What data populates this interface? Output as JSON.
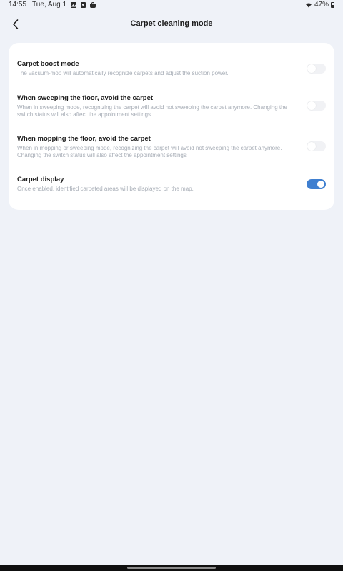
{
  "status_bar": {
    "time": "14:55",
    "date": "Tue, Aug 1",
    "battery": "47%",
    "icons": [
      "gallery-icon",
      "notification-icon",
      "basket-icon",
      "wifi-icon",
      "battery-icon"
    ]
  },
  "header": {
    "title": "Carpet cleaning mode",
    "back_icon": "chevron-left-icon"
  },
  "settings": [
    {
      "title": "Carpet boost mode",
      "description": "The vacuum-mop will automatically recognize carpets and adjust the suction power.",
      "enabled": false
    },
    {
      "title": "When sweeping the floor, avoid the carpet",
      "description": "When in sweeping mode, recognizing the carpet will avoid not sweeping the carpet anymore. Changing the switch status will also affect the appointment settings",
      "enabled": false
    },
    {
      "title": "When mopping the floor, avoid the carpet",
      "description": "When in mopping or sweeping mode, recognizing the carpet will avoid not sweeping the carpet anymore. Changing the switch status will also affect the appointment settings",
      "enabled": false
    },
    {
      "title": "Carpet display",
      "description": "Once enabled, identified carpeted areas will be displayed on the map.",
      "enabled": true
    }
  ],
  "colors": {
    "background": "#eff2f8",
    "card": "#ffffff",
    "toggle_on": "#3f7fd0",
    "toggle_off": "#f1f2f5",
    "description_text": "#a7adb6"
  }
}
